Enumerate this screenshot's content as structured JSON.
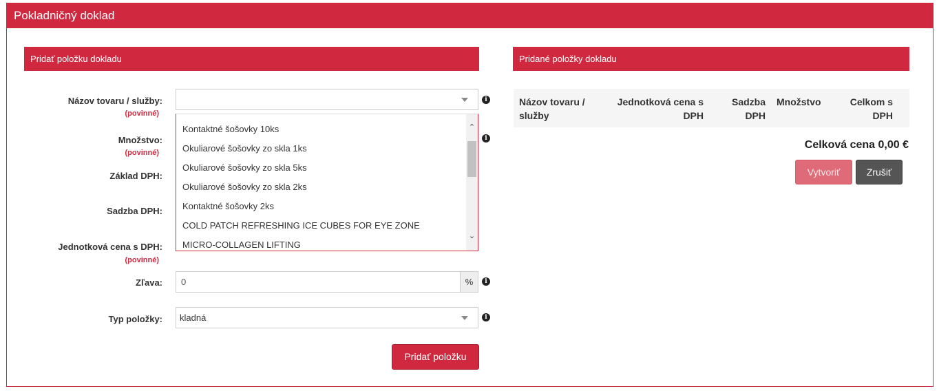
{
  "panel": {
    "title": "Pokladničný doklad"
  },
  "left": {
    "section_title": "Pridať položku dokladu",
    "fields": {
      "product": {
        "label": "Názov tovaru / služby:",
        "required": "(povinné)",
        "value": ""
      },
      "quantity": {
        "label": "Množstvo:",
        "required": "(povinné)"
      },
      "vat_base": {
        "label": "Základ DPH:"
      },
      "vat_rate": {
        "label": "Sadzba DPH:"
      },
      "unit_price": {
        "label": "Jednotková cena s DPH:",
        "required": "(povinné)"
      },
      "discount": {
        "label": "Zľava:",
        "value": "0",
        "unit": "%"
      },
      "item_type": {
        "label": "Typ položky:",
        "value": "kladná"
      }
    },
    "dropdown_options": [
      "Kontaktné šošovky 10ks",
      "Okuliarové šošovky zo skla 1ks",
      "Okuliarové šošovky zo skla 5ks",
      "Okuliarové šošovky zo skla 2ks",
      "Kontaktné šošovky 2ks",
      "COLD PATCH REFRESHING ICE CUBES FOR EYE ZONE",
      "MICRO-COLLAGEN LIFTING"
    ],
    "add_button": "Pridať položku"
  },
  "right": {
    "section_title": "Pridané položky dokladu",
    "table_headers": {
      "name": [
        "Názov tovaru /",
        "služby"
      ],
      "unit_price": [
        "Jednotková cena s",
        "DPH"
      ],
      "vat_rate": [
        "Sadzba",
        "DPH"
      ],
      "quantity": [
        "Množstvo"
      ],
      "total": [
        "Celkom s",
        "DPH"
      ]
    },
    "total_label": "Celková cena 0,00 €",
    "create_button": "Vytvoriť",
    "cancel_button": "Zrušiť"
  },
  "colors": {
    "accent": "#d0293f",
    "dark_button": "#555555"
  },
  "icons": {
    "info": "info-circle-icon",
    "caret": "caret-down-icon"
  }
}
